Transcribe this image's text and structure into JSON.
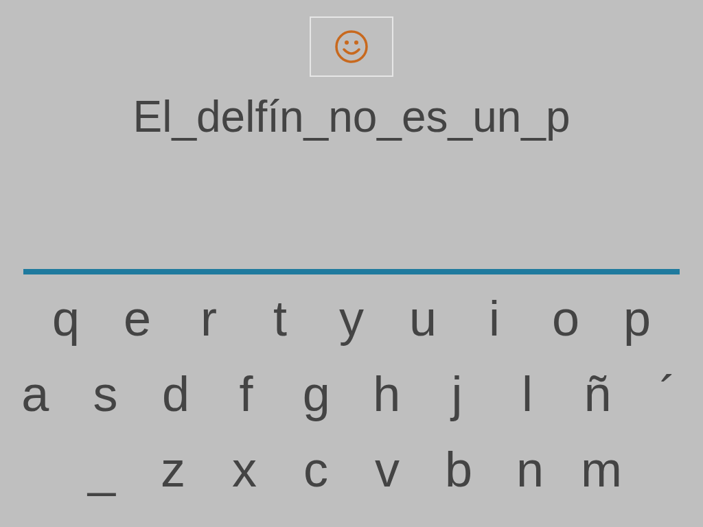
{
  "answer": {
    "text": "El_delfín_no_es_un_p"
  },
  "keyboard": {
    "rows": [
      [
        "q",
        "e",
        "r",
        "t",
        "y",
        "u",
        "i",
        "o",
        "p"
      ],
      [
        "a",
        "s",
        "d",
        "f",
        "g",
        "h",
        "j",
        "l",
        "ñ",
        "´"
      ],
      [
        "_",
        "z",
        "x",
        "c",
        "v",
        "b",
        "n",
        "m"
      ]
    ]
  }
}
